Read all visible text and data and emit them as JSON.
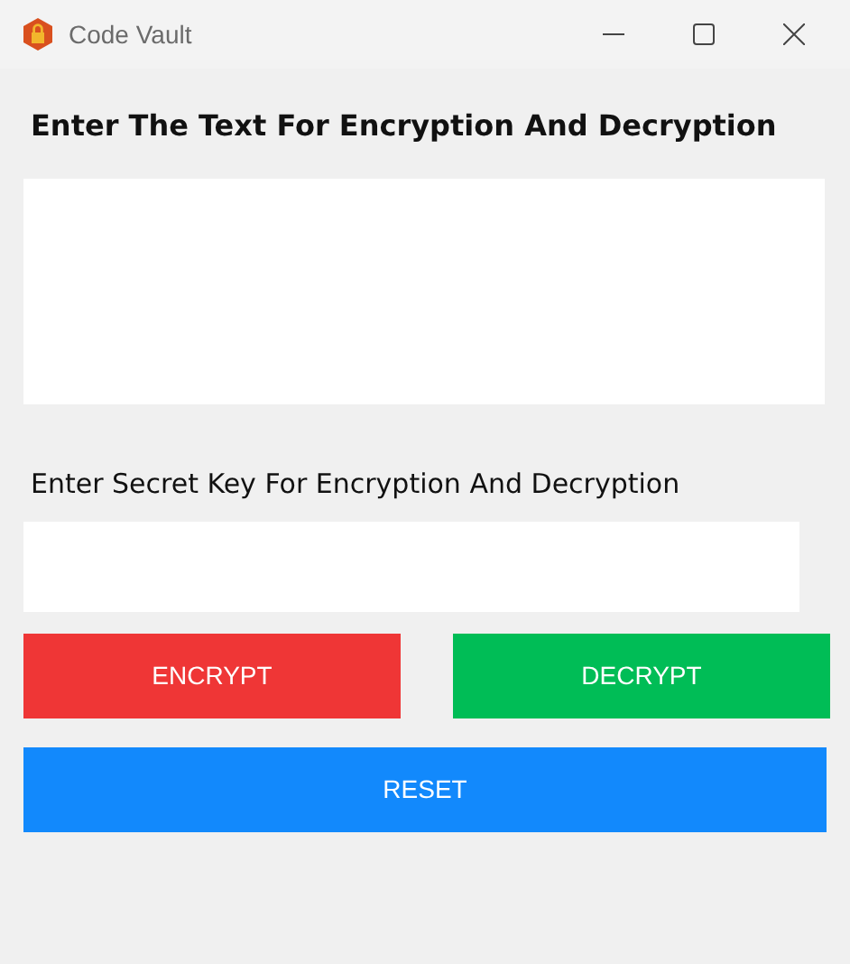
{
  "window": {
    "title": "Code Vault"
  },
  "text_label": "Enter The Text For Encryption And Decryption",
  "key_label": "Enter Secret Key For Encryption And Decryption",
  "buttons": [
    {
      "label": "ENCRYPT",
      "kind": "encrypt"
    },
    {
      "label": "DECRYPT",
      "kind": "decrypt"
    },
    {
      "label": "RESET",
      "kind": "reset"
    }
  ]
}
